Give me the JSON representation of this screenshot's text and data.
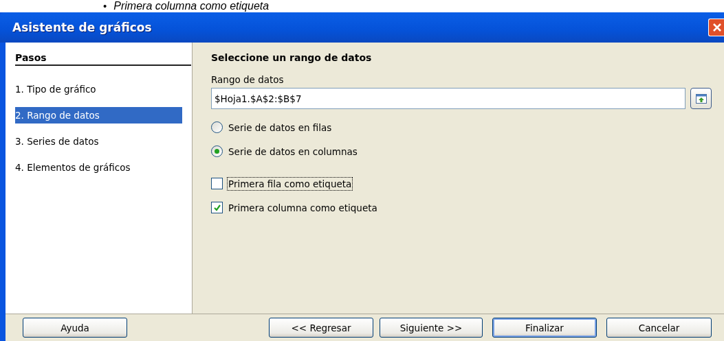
{
  "background_bullet": "•",
  "background_text": "Primera columna como etiqueta",
  "window": {
    "title": "Asistente de gráficos"
  },
  "steps": {
    "heading": "Pasos",
    "items": [
      {
        "label": "1. Tipo de gráfico",
        "selected": false
      },
      {
        "label": "2. Rango de datos",
        "selected": true
      },
      {
        "label": "3. Series de datos",
        "selected": false
      },
      {
        "label": "4. Elementos de gráficos",
        "selected": false
      }
    ]
  },
  "content": {
    "heading": "Seleccione un rango de datos",
    "range_label": "Rango de datos",
    "range_value": "$Hoja1.$A$2:$B$7",
    "radios": [
      {
        "label": "Serie de datos en filas",
        "selected": false
      },
      {
        "label": "Serie de datos en columnas",
        "selected": true
      }
    ],
    "checkboxes": [
      {
        "label": "Primera fila como etiqueta",
        "checked": false,
        "focused": true
      },
      {
        "label": "Primera columna como etiqueta",
        "checked": true,
        "focused": false
      }
    ]
  },
  "buttons": [
    {
      "label": "Ayuda",
      "default": false
    },
    {
      "label": "<< Regresar",
      "default": false
    },
    {
      "label": "Siguiente >>",
      "default": false
    },
    {
      "label": "Finalizar",
      "default": true
    },
    {
      "label": "Cancelar",
      "default": false
    }
  ]
}
